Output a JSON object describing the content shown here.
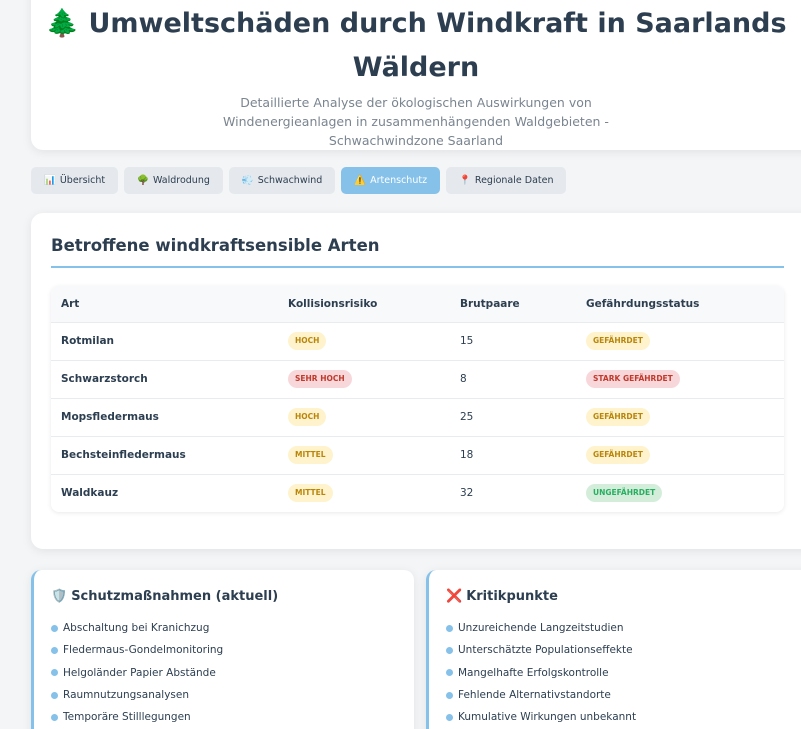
{
  "header": {
    "title_icon": "🌲",
    "title": "Umweltschäden durch Windkraft in Saarlands Wäldern",
    "subtitle": "Detaillierte Analyse der ökologischen Auswirkungen von Windenergieanlagen in zusammenhängenden Waldgebieten - Schwachwindzone Saarland"
  },
  "tabs": [
    {
      "icon": "📊",
      "label": "Übersicht"
    },
    {
      "icon": "🌳",
      "label": "Waldrodung"
    },
    {
      "icon": "💨",
      "label": "Schwachwind"
    },
    {
      "icon": "⚠️",
      "label": "Artenschutz",
      "active": true
    },
    {
      "icon": "📍",
      "label": "Regionale Daten"
    }
  ],
  "species": {
    "heading": "Betroffene windkraftsensible Arten",
    "columns": [
      "Art",
      "Kollisionsrisiko",
      "Brutpaare",
      "Gefährdungsstatus"
    ],
    "rows": [
      {
        "art": "Rotmilan",
        "risk": "Hoch",
        "pairs": "15",
        "status": "Gefährdet"
      },
      {
        "art": "Schwarzstorch",
        "risk": "Sehr hoch",
        "pairs": "8",
        "status": "Stark gefährdet"
      },
      {
        "art": "Mopsfledermaus",
        "risk": "Hoch",
        "pairs": "25",
        "status": "Gefährdet"
      },
      {
        "art": "Bechsteinfledermaus",
        "risk": "Mittel",
        "pairs": "18",
        "status": "Gefährdet"
      },
      {
        "art": "Waldkauz",
        "risk": "Mittel",
        "pairs": "32",
        "status": "Ungefährdet"
      }
    ]
  },
  "protection": {
    "icon": "🛡️",
    "title": "Schutzmaßnahmen (aktuell)",
    "items": [
      "Abschaltung bei Kranichzug",
      "Fledermaus-Gondelmonitoring",
      "Helgoländer Papier Abstände",
      "Raumnutzungsanalysen",
      "Temporäre Stilllegungen"
    ]
  },
  "criticism": {
    "icon": "❌",
    "title": "Kritikpunkte",
    "items": [
      "Unzureichende Langzeitstudien",
      "Unterschätzte Populationseffekte",
      "Mangelhafte Erfolgskontrolle",
      "Fehlende Alternativstandorte",
      "Kumulative Wirkungen unbekannt"
    ]
  },
  "colors": {
    "accent": "#85c1e9",
    "risk_high": "#b8860b",
    "risk_very_high": "#c0392b",
    "status_ok": "#27ae60"
  }
}
